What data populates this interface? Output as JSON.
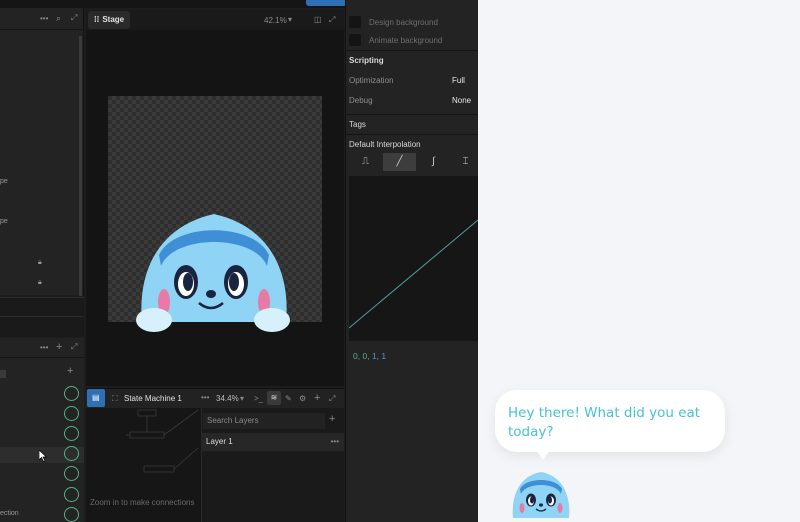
{
  "stage": {
    "title": "Stage",
    "zoom": "42.1%"
  },
  "state_machine": {
    "title": "State Machine 1",
    "zoom": "34.4%",
    "hint": "Zoom in to make connections"
  },
  "layers": {
    "search_placeholder": "Search Layers",
    "items": [
      "Layer 1"
    ]
  },
  "left_panel": {
    "truncated_labels": [
      "pe",
      "pe"
    ],
    "bottom_truncated": "ection"
  },
  "inspector": {
    "design_background": "Design background",
    "animate_background": "Animate background",
    "scripting": "Scripting",
    "optimization_label": "Optimization",
    "optimization_value": "Full",
    "debug_label": "Debug",
    "debug_value": "None",
    "tags": "Tags",
    "default_interpolation": "Default Interpolation",
    "curve_values": [
      "0,",
      "0,",
      "1,",
      "1"
    ]
  },
  "preview": {
    "message": "Hey there! What did you eat today?"
  },
  "colors": {
    "accent_green": "#4fb28a",
    "accent_blue": "#2f6fb5",
    "bubble_text": "#45c3d3",
    "character_body": "#8fd3f5",
    "character_band": "#3f8fd6"
  },
  "icons": [
    "more-icon",
    "search-icon",
    "expand-icon",
    "grid-icon",
    "chevron-down-icon",
    "panel-icon",
    "lock-icon",
    "plus-icon",
    "state-machine-icon",
    "terminal-icon",
    "layers-icon",
    "edit-icon",
    "settings-icon"
  ]
}
